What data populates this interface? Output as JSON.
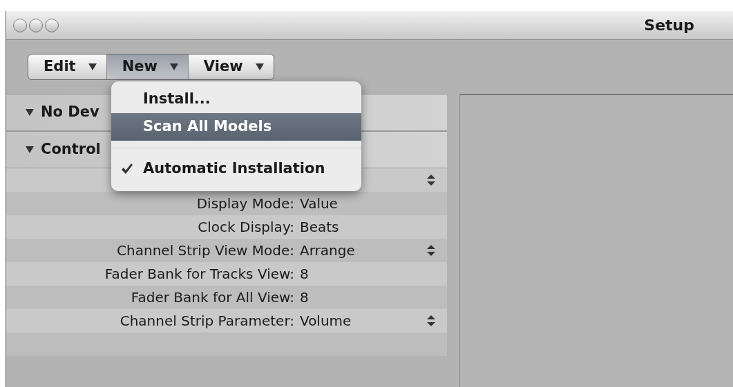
{
  "window": {
    "title": "Setup"
  },
  "toolbar": {
    "buttons": [
      {
        "label": "Edit",
        "selected": false
      },
      {
        "label": "New",
        "selected": true
      },
      {
        "label": "View",
        "selected": false
      }
    ]
  },
  "menu": {
    "items": [
      {
        "kind": "item",
        "label": "Install...",
        "highlighted": false,
        "checked": false
      },
      {
        "kind": "item",
        "label": "Scan All Models",
        "highlighted": true,
        "checked": false
      },
      {
        "kind": "separator"
      },
      {
        "kind": "item",
        "label": "Automatic Installation",
        "highlighted": false,
        "checked": true
      }
    ]
  },
  "sections": [
    {
      "title": "No Dev",
      "expanded": true
    },
    {
      "title": "Control",
      "expanded": true
    }
  ],
  "rows": [
    {
      "stepper": true
    },
    {
      "label": "Display Mode:",
      "value": "Value",
      "stepper": false
    },
    {
      "label": "Clock Display:",
      "value": "Beats",
      "stepper": false
    },
    {
      "label": "Channel Strip View Mode:",
      "value": "Arrange",
      "stepper": true
    },
    {
      "label": "Fader Bank for Tracks View:",
      "value": "8",
      "stepper": false
    },
    {
      "label": "Fader Bank for All View:",
      "value": "8",
      "stepper": false
    },
    {
      "label": "Channel Strip Parameter:",
      "value": "Volume",
      "stepper": true
    },
    {
      "stepper": false
    }
  ]
}
